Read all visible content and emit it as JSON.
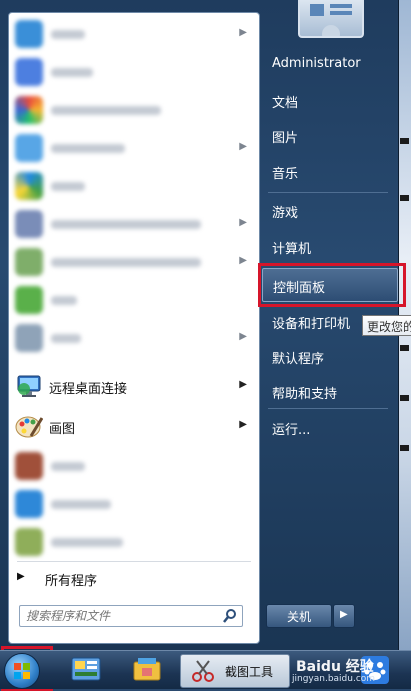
{
  "start_menu": {
    "pinned_programs": [
      {
        "label": "远程桌面连接",
        "has_submenu": true,
        "icon": "remote-desktop-icon"
      },
      {
        "label": "画图",
        "has_submenu": true,
        "icon": "paint-icon"
      }
    ],
    "all_programs_label": "所有程序",
    "search_placeholder": "搜索程序和文件"
  },
  "right_pane": {
    "items": [
      {
        "label": "Administrator",
        "name": "user-administrator"
      },
      {
        "label": "文档",
        "name": "documents"
      },
      {
        "label": "图片",
        "name": "pictures"
      },
      {
        "label": "音乐",
        "name": "music"
      },
      {
        "label": "游戏",
        "name": "games"
      },
      {
        "label": "计算机",
        "name": "computer"
      },
      {
        "label": "控制面板",
        "name": "control-panel",
        "selected": true
      },
      {
        "label": "设备和打印机",
        "name": "devices-and-printers"
      },
      {
        "label": "默认程序",
        "name": "default-programs"
      },
      {
        "label": "帮助和支持",
        "name": "help-and-support"
      },
      {
        "label": "运行...",
        "name": "run"
      }
    ],
    "tooltip": "更改您的",
    "shutdown_label": "关机"
  },
  "taskbar": {
    "active_task_label": "截图工具"
  },
  "watermark": {
    "text": "Baidu 经验",
    "url": "jingyan.baidu.com"
  },
  "colors": {
    "highlight_red": "#d6152a",
    "menu_dark": "#1f3c5e"
  }
}
